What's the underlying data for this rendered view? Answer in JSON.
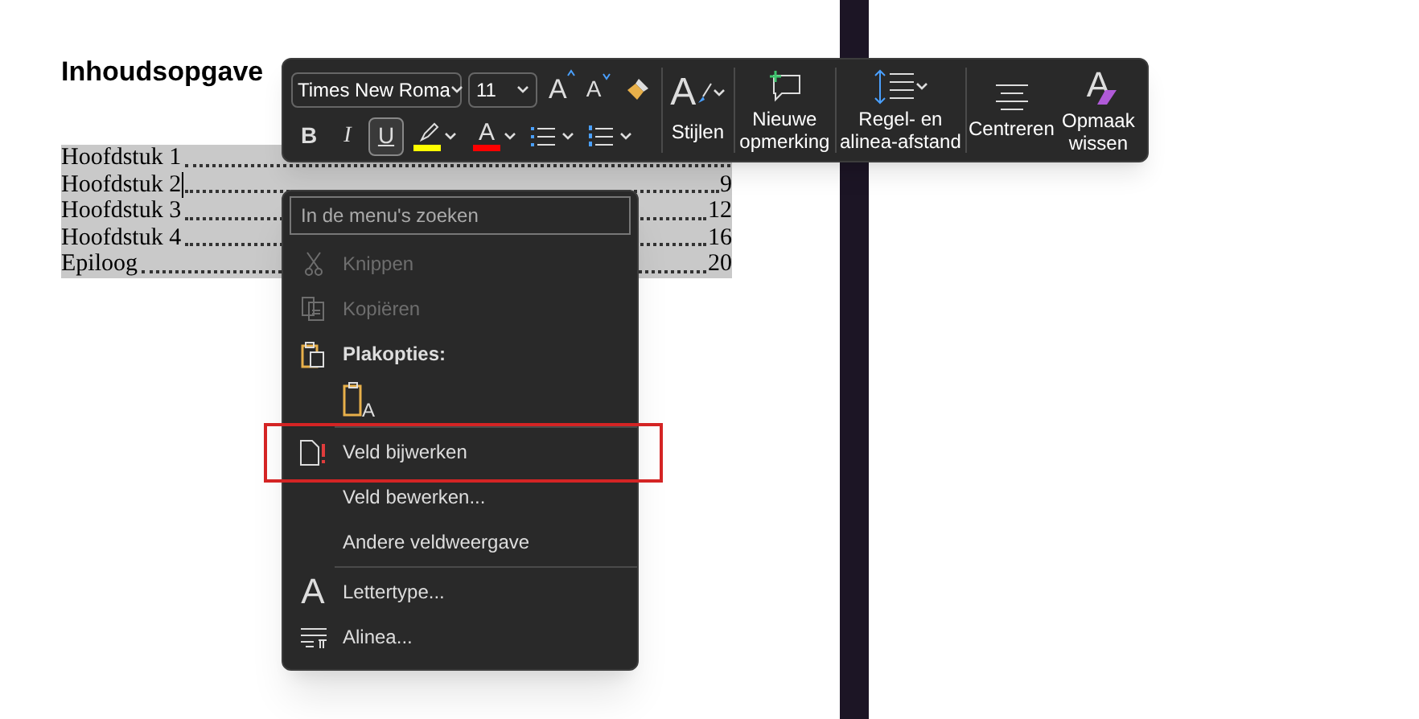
{
  "document": {
    "heading": "Inhoudsopgave",
    "toc": [
      {
        "title": "Hoofdstuk 1",
        "cursor": false
      },
      {
        "title": "Hoofdstuk 2",
        "page": "9",
        "cursor": true
      },
      {
        "title": "Hoofdstuk 3",
        "page": "12",
        "cursor": false
      },
      {
        "title": "Hoofdstuk 4",
        "page": "16",
        "cursor": false
      },
      {
        "title": "Epiloog",
        "page": "20",
        "cursor": false
      }
    ]
  },
  "mini_toolbar": {
    "font": "Times New Roma",
    "size": "11",
    "grow_glyph": "A",
    "shrink_glyph": "A",
    "format_buttons": [
      {
        "label": "B",
        "selected": false
      },
      {
        "label": "I",
        "selected": false
      },
      {
        "label": "U",
        "selected": true
      }
    ],
    "font_color_glyph": "A",
    "styles": {
      "glyph": "A",
      "label": "Stijlen"
    },
    "actions": [
      {
        "kind": "comment",
        "label": "Nieuwe opmerking"
      },
      {
        "kind": "spacing",
        "label": "Regel- en alinea-afstand"
      },
      {
        "kind": "center",
        "label": "Centreren"
      },
      {
        "kind": "clear",
        "glyph": "A",
        "label": "Opmaak wissen"
      }
    ]
  },
  "context_menu": {
    "search": {
      "placeholder": "In de menu's zoeken"
    },
    "items": [
      {
        "kind": "cut",
        "label": "Knippen",
        "disabled": true
      },
      {
        "kind": "copy",
        "label": "Kopiëren",
        "disabled": true
      },
      {
        "kind": "paste_header",
        "label": "Plakopties:"
      },
      {
        "kind": "paste_option",
        "glyph": "A"
      },
      {
        "kind": "separator"
      },
      {
        "kind": "update_field",
        "label": "Veld bijwerken",
        "disabled": false,
        "highlighted": true
      },
      {
        "kind": "plain",
        "label": "Veld bewerken...",
        "disabled": false
      },
      {
        "kind": "plain",
        "label": "Andere veldweergave",
        "disabled": false
      },
      {
        "kind": "separator"
      },
      {
        "kind": "font",
        "glyph": "A",
        "label": "Lettertype...",
        "disabled": false
      },
      {
        "kind": "paragraph",
        "label": "Alinea...",
        "disabled": false
      }
    ]
  }
}
